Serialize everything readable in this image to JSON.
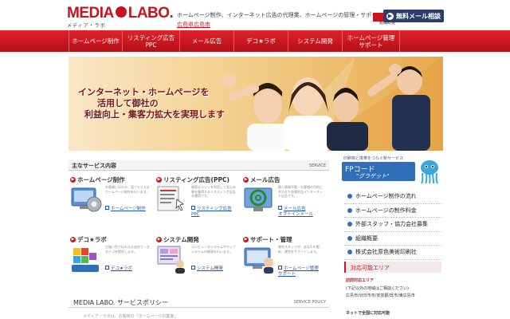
{
  "header": {
    "logo_main": "MEDIA LABO.",
    "logo_sub": "メディア・ラボ",
    "tagline": "ホームページ制作、インターネット広告の代理業、ホームページの管理・サポートはメディ",
    "area_link": "広島県広島市",
    "badge_text": "組織概要",
    "cta_label": "無料メール相談"
  },
  "nav": {
    "items": [
      {
        "label": "ホームページ制作"
      },
      {
        "label": "リスティング広告\nPPC"
      },
      {
        "label": "メール広告"
      },
      {
        "label": "デコ★ラボ"
      },
      {
        "label": "システム開発"
      },
      {
        "label": "ホームページ管理\nサポート"
      }
    ]
  },
  "hero": {
    "lines": [
      "インターネット・ホームページを",
      "活用して御社の",
      "利益向上・集客力拡大を実現します"
    ]
  },
  "services": {
    "title": "主なサービス内容",
    "title_en": "SERVICE",
    "items": [
      {
        "title": "ホームページ制作",
        "desc": "お客様に伝わる、見てもらえるホームページ制作を行います。",
        "link": "ホームページ制作"
      },
      {
        "title": "リスティング広告(PPC)",
        "desc": "検索エンジンを利用して見込み客を獲得するリスティング広告の運用です。",
        "link": "リスティング広告\nPPC"
      },
      {
        "title": "メール広告",
        "desc": "個人情報不要・お客様の目的に合わせた効果的なインターネット広告です。",
        "link": "メール広告\nオプトインメール"
      },
      {
        "title": "デコ★ラボ",
        "desc": "力強い色で伝わるお店作り・文字デコを提供します。",
        "link": "デコ★ラボ"
      },
      {
        "title": "システム開発",
        "desc": "コンピュータシステムやウェブシステムの開発を行います。",
        "link": "システム開発"
      },
      {
        "title": "サポート・管理",
        "desc": "専任スタッフが、あなたの更新・運営をサポートします。",
        "link": "ホームページ管理\nサポート"
      }
    ]
  },
  "policy": {
    "title": "MEDIA LABO. サービスポリシー",
    "title_en": "SERVICE POLICY",
    "text": "メディア・ラボは、お客様の「ホームページの集客」"
  },
  "sidebar": {
    "fp_caption": "印刷物と携帯をつなぐ新サービス",
    "fp_title": "FPコード",
    "fp_sub": "\"グラゲット\"",
    "menu": [
      {
        "label": "ホームページ制作の流れ"
      },
      {
        "label": "ホームページの制作料金"
      },
      {
        "label": "外部スタッフ・協力会社募集"
      },
      {
        "label": "組織概要"
      },
      {
        "label": "株式会社原色美術印刷社"
      }
    ],
    "area_title": "対応可能エリア",
    "area_lines": [
      "訪問対応エリア",
      "(下記以外の地域はご相談ください)",
      "広島市/廿日市市/安芸郡/呉市/東広島市",
      "ネットで全国に対応可能"
    ]
  },
  "colors": {
    "brand_red": "#c8141e",
    "nav_red": "#d61a23",
    "cta_navy": "#2b3d6b",
    "accent_blue": "#2e6fb7"
  }
}
